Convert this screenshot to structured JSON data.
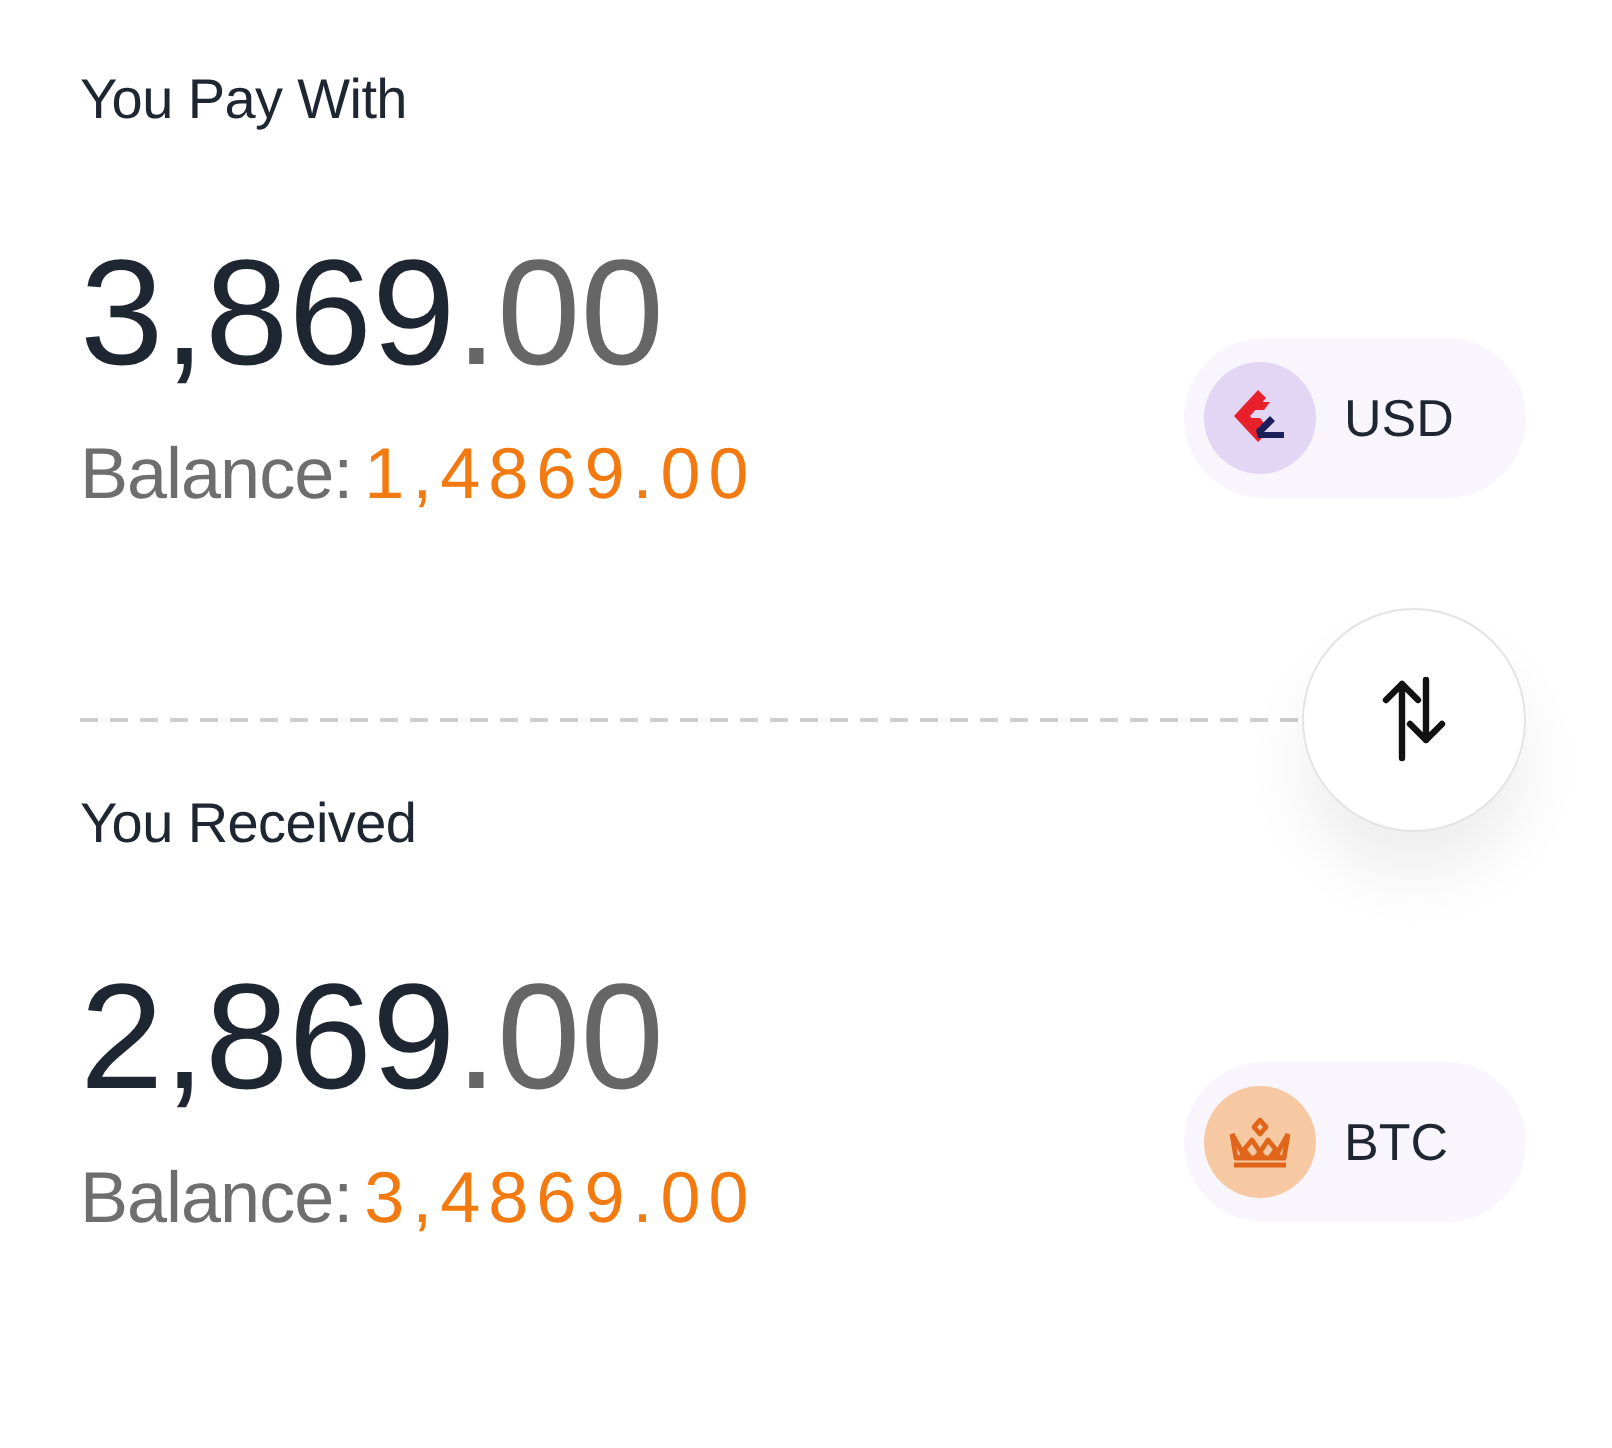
{
  "sections": [
    {
      "title": "You Pay With",
      "amount": {
        "whole": "3,869",
        "fraction": ".00"
      },
      "balance": {
        "label": "Balance:",
        "value": "1,4869.00"
      },
      "currency": {
        "code": "USD"
      }
    },
    {
      "title": "You Received",
      "amount": {
        "whole": "2,869",
        "fraction": ".00"
      },
      "balance": {
        "label": "Balance:",
        "value": "3,4869.00"
      },
      "currency": {
        "code": "BTC"
      }
    }
  ]
}
